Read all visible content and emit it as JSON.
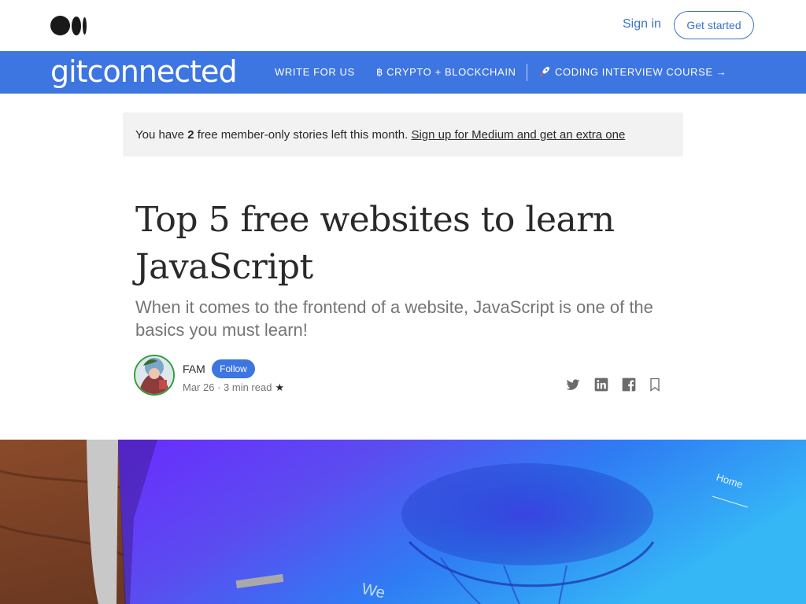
{
  "header": {
    "logo_icon": "medium-logo-icon",
    "signin_label": "Sign in",
    "getstarted_label": "Get started"
  },
  "publication": {
    "name": "gitconnected",
    "nav": [
      {
        "label": "WRITE FOR US"
      },
      {
        "label": "฿ CRYPTO + BLOCKCHAIN"
      },
      {
        "label": "CODING INTERVIEW COURSE →",
        "icon": "rocket-icon"
      }
    ],
    "bar_color": "#3d75e1"
  },
  "banner": {
    "prefix": "You have ",
    "count": "2",
    "middle": " free member-only stories left this month. ",
    "link": "Sign up for Medium and get an extra one"
  },
  "article": {
    "title": "Top 5 free websites to learn JavaScript",
    "subtitle": "When it comes to the frontend of a website, JavaScript is one of the basics you must learn!",
    "author": "FAM",
    "follow_label": "Follow",
    "date": "Mar 26",
    "dot": " · ",
    "read_time": "3 min read",
    "member_star": "★"
  },
  "share_icons": [
    "twitter-icon",
    "linkedin-icon",
    "facebook-icon",
    "bookmark-icon"
  ],
  "hero": {
    "text_home": "Home",
    "text_partial": "We"
  },
  "colors": {
    "accent": "#3d75e1",
    "link": "#3b73c9",
    "avatar_ring": "#2f9f3a"
  }
}
